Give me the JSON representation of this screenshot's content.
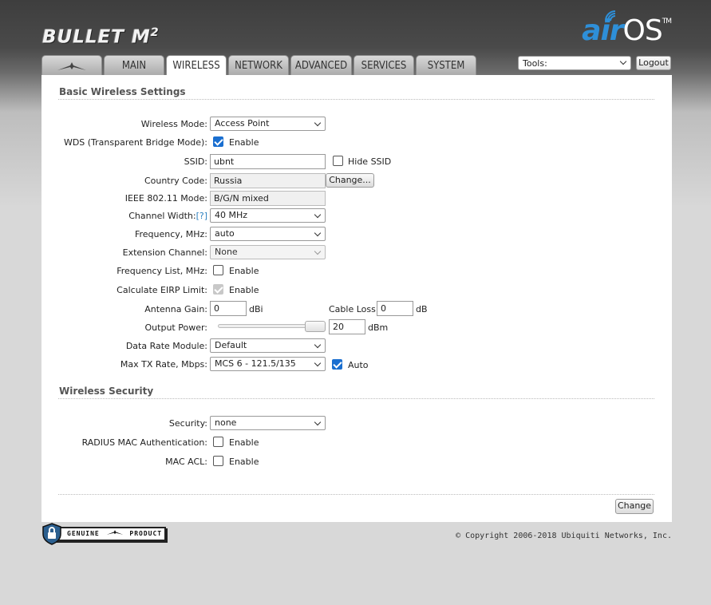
{
  "header": {
    "device_name": "BULLET M",
    "device_suffix": "2",
    "brand_air": "air",
    "brand_os": "OS",
    "brand_tm": "TM"
  },
  "tabs": [
    {
      "label": "",
      "icon": "ubiquiti-logo-icon"
    },
    {
      "label": "MAIN"
    },
    {
      "label": "WIRELESS",
      "active": true
    },
    {
      "label": "NETWORK"
    },
    {
      "label": "ADVANCED"
    },
    {
      "label": "SERVICES"
    },
    {
      "label": "SYSTEM"
    }
  ],
  "tools": {
    "value": "Tools:"
  },
  "logout_label": "Logout",
  "basic": {
    "title": "Basic Wireless Settings",
    "wireless_mode_label": "Wireless Mode:",
    "wireless_mode_value": "Access Point",
    "wds_label": "WDS (Transparent Bridge Mode):",
    "wds_enable": "Enable",
    "ssid_label": "SSID:",
    "ssid_value": "ubnt",
    "hide_ssid": "Hide SSID",
    "country_label": "Country Code:",
    "country_value": "Russia",
    "country_change": "Change...",
    "ieee_label": "IEEE 802.11 Mode:",
    "ieee_value": "B/G/N mixed",
    "channel_width_label": "Channel Width:",
    "channel_width_help": "[?]",
    "channel_width_value": "40 MHz",
    "frequency_label": "Frequency, MHz:",
    "frequency_value": "auto",
    "ext_channel_label": "Extension Channel:",
    "ext_channel_value": "None",
    "freq_list_label": "Frequency List, MHz:",
    "freq_list_enable": "Enable",
    "eirp_label": "Calculate EIRP Limit:",
    "eirp_enable": "Enable",
    "antenna_gain_label": "Antenna Gain:",
    "antenna_gain_value": "0",
    "antenna_gain_unit": "dBi",
    "cable_loss_label": "Cable Loss:",
    "cable_loss_value": "0",
    "cable_loss_unit": "dB",
    "output_power_label": "Output Power:",
    "output_power_value": "20",
    "output_power_unit": "dBm",
    "output_power_level": 1.0,
    "data_rate_label": "Data Rate Module:",
    "data_rate_value": "Default",
    "max_tx_label": "Max TX Rate, Mbps:",
    "max_tx_value": "MCS 6 - 121.5/135",
    "max_tx_auto": "Auto"
  },
  "security": {
    "title": "Wireless Security",
    "security_label": "Security:",
    "security_value": "none",
    "radius_label": "RADIUS MAC Authentication:",
    "radius_enable": "Enable",
    "macacl_label": "MAC ACL:",
    "macacl_enable": "Enable"
  },
  "change_label": "Change",
  "footer": {
    "genuine_left": "GENUINE",
    "genuine_right": "PRODUCT",
    "copyright": "© Copyright 2006-2018 Ubiquiti Networks, Inc."
  },
  "colors": {
    "accent": "#2e8fd8",
    "checkbox": "#1a6fd0",
    "help_link": "#2a7fbf"
  }
}
